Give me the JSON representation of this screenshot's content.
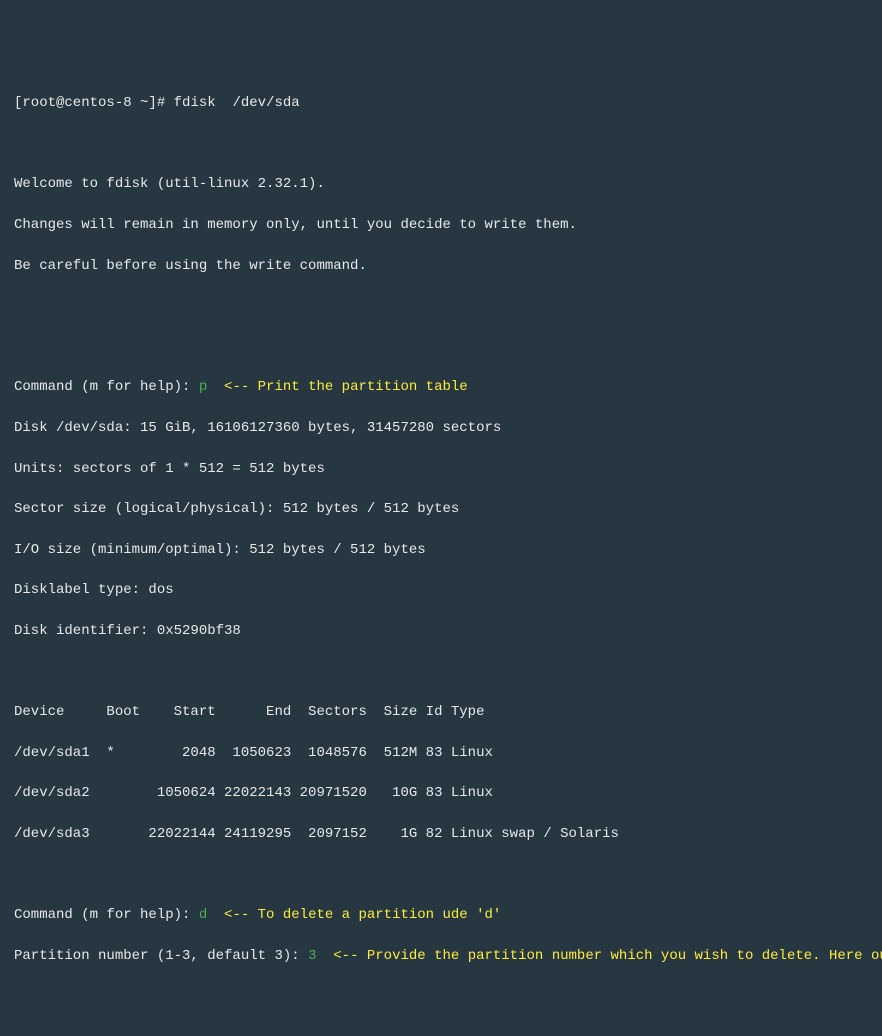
{
  "prompt": "[root@centos-8 ~]# ",
  "cmd": "fdisk  /dev/sda",
  "welcome1": "Welcome to fdisk (util-linux 2.32.1).",
  "welcome2": "Changes will remain in memory only, until you decide to write them.",
  "welcome3": "Be careful before using the write command.",
  "cmd_prompt": "Command (m for help): ",
  "p_input": "p",
  "p_comment": "  <-- Print the partition table",
  "disk_info1": "Disk /dev/sda: 15 GiB, 16106127360 bytes, 31457280 sectors",
  "disk_info2": "Units: sectors of 1 * 512 = 512 bytes",
  "disk_info3": "Sector size (logical/physical): 512 bytes / 512 bytes",
  "disk_info4": "I/O size (minimum/optimal): 512 bytes / 512 bytes",
  "disk_info5": "Disklabel type: dos",
  "disk_info6": "Disk identifier: 0x5290bf38",
  "table_header": "Device     Boot    Start      End  Sectors  Size Id Type",
  "table_row1": "/dev/sda1  *        2048  1050623  1048576  512M 83 Linux",
  "table_row2": "/dev/sda2        1050624 22022143 20971520   10G 83 Linux",
  "table_row3": "/dev/sda3       22022144 24119295  2097152    1G 82 Linux swap / Solaris",
  "d_input": "d",
  "d_comment": "  <-- To delete a partition ude 'd'",
  "part_prompt": "Partition number (1-3, default 3): ",
  "part_input": "3",
  "part_comment": "  <-- Provide the partition number which you wish to delete. Here our "
}
